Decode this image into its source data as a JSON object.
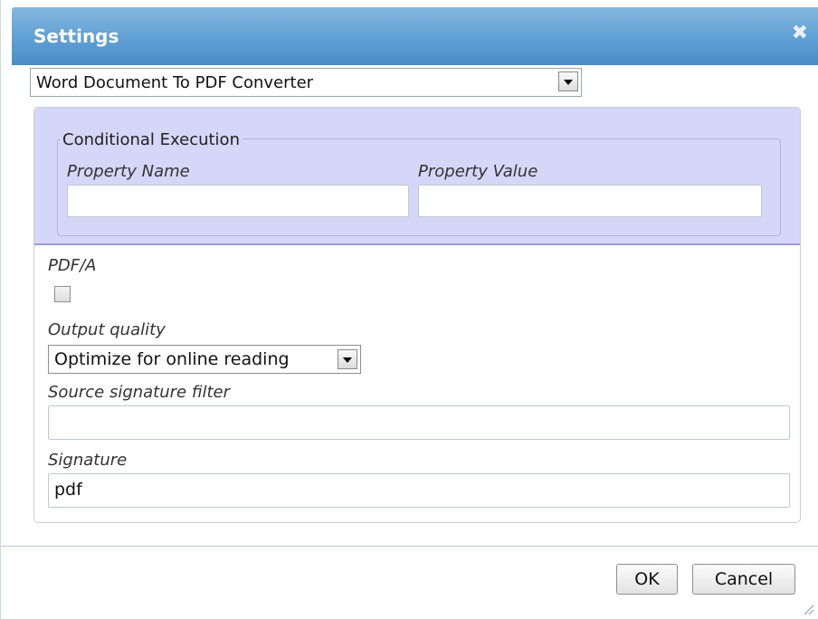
{
  "dialog": {
    "title": "Settings",
    "close_glyph": "✖"
  },
  "converter": {
    "selected": "Word Document To PDF Converter"
  },
  "conditional": {
    "legend": "Conditional Execution",
    "property_name_label": "Property Name",
    "property_name_value": "",
    "property_value_label": "Property Value",
    "property_value_value": ""
  },
  "pdfa": {
    "label": "PDF/A",
    "checked": false
  },
  "output_quality": {
    "label": "Output quality",
    "selected": "Optimize for online reading"
  },
  "source_signature_filter": {
    "label": "Source signature filter",
    "value": ""
  },
  "signature": {
    "label": "Signature",
    "value": "pdf"
  },
  "buttons": {
    "ok": "OK",
    "cancel": "Cancel"
  },
  "colors": {
    "titlebar": "#5f9fd3",
    "conditional_bg": "#d6d6f8"
  }
}
